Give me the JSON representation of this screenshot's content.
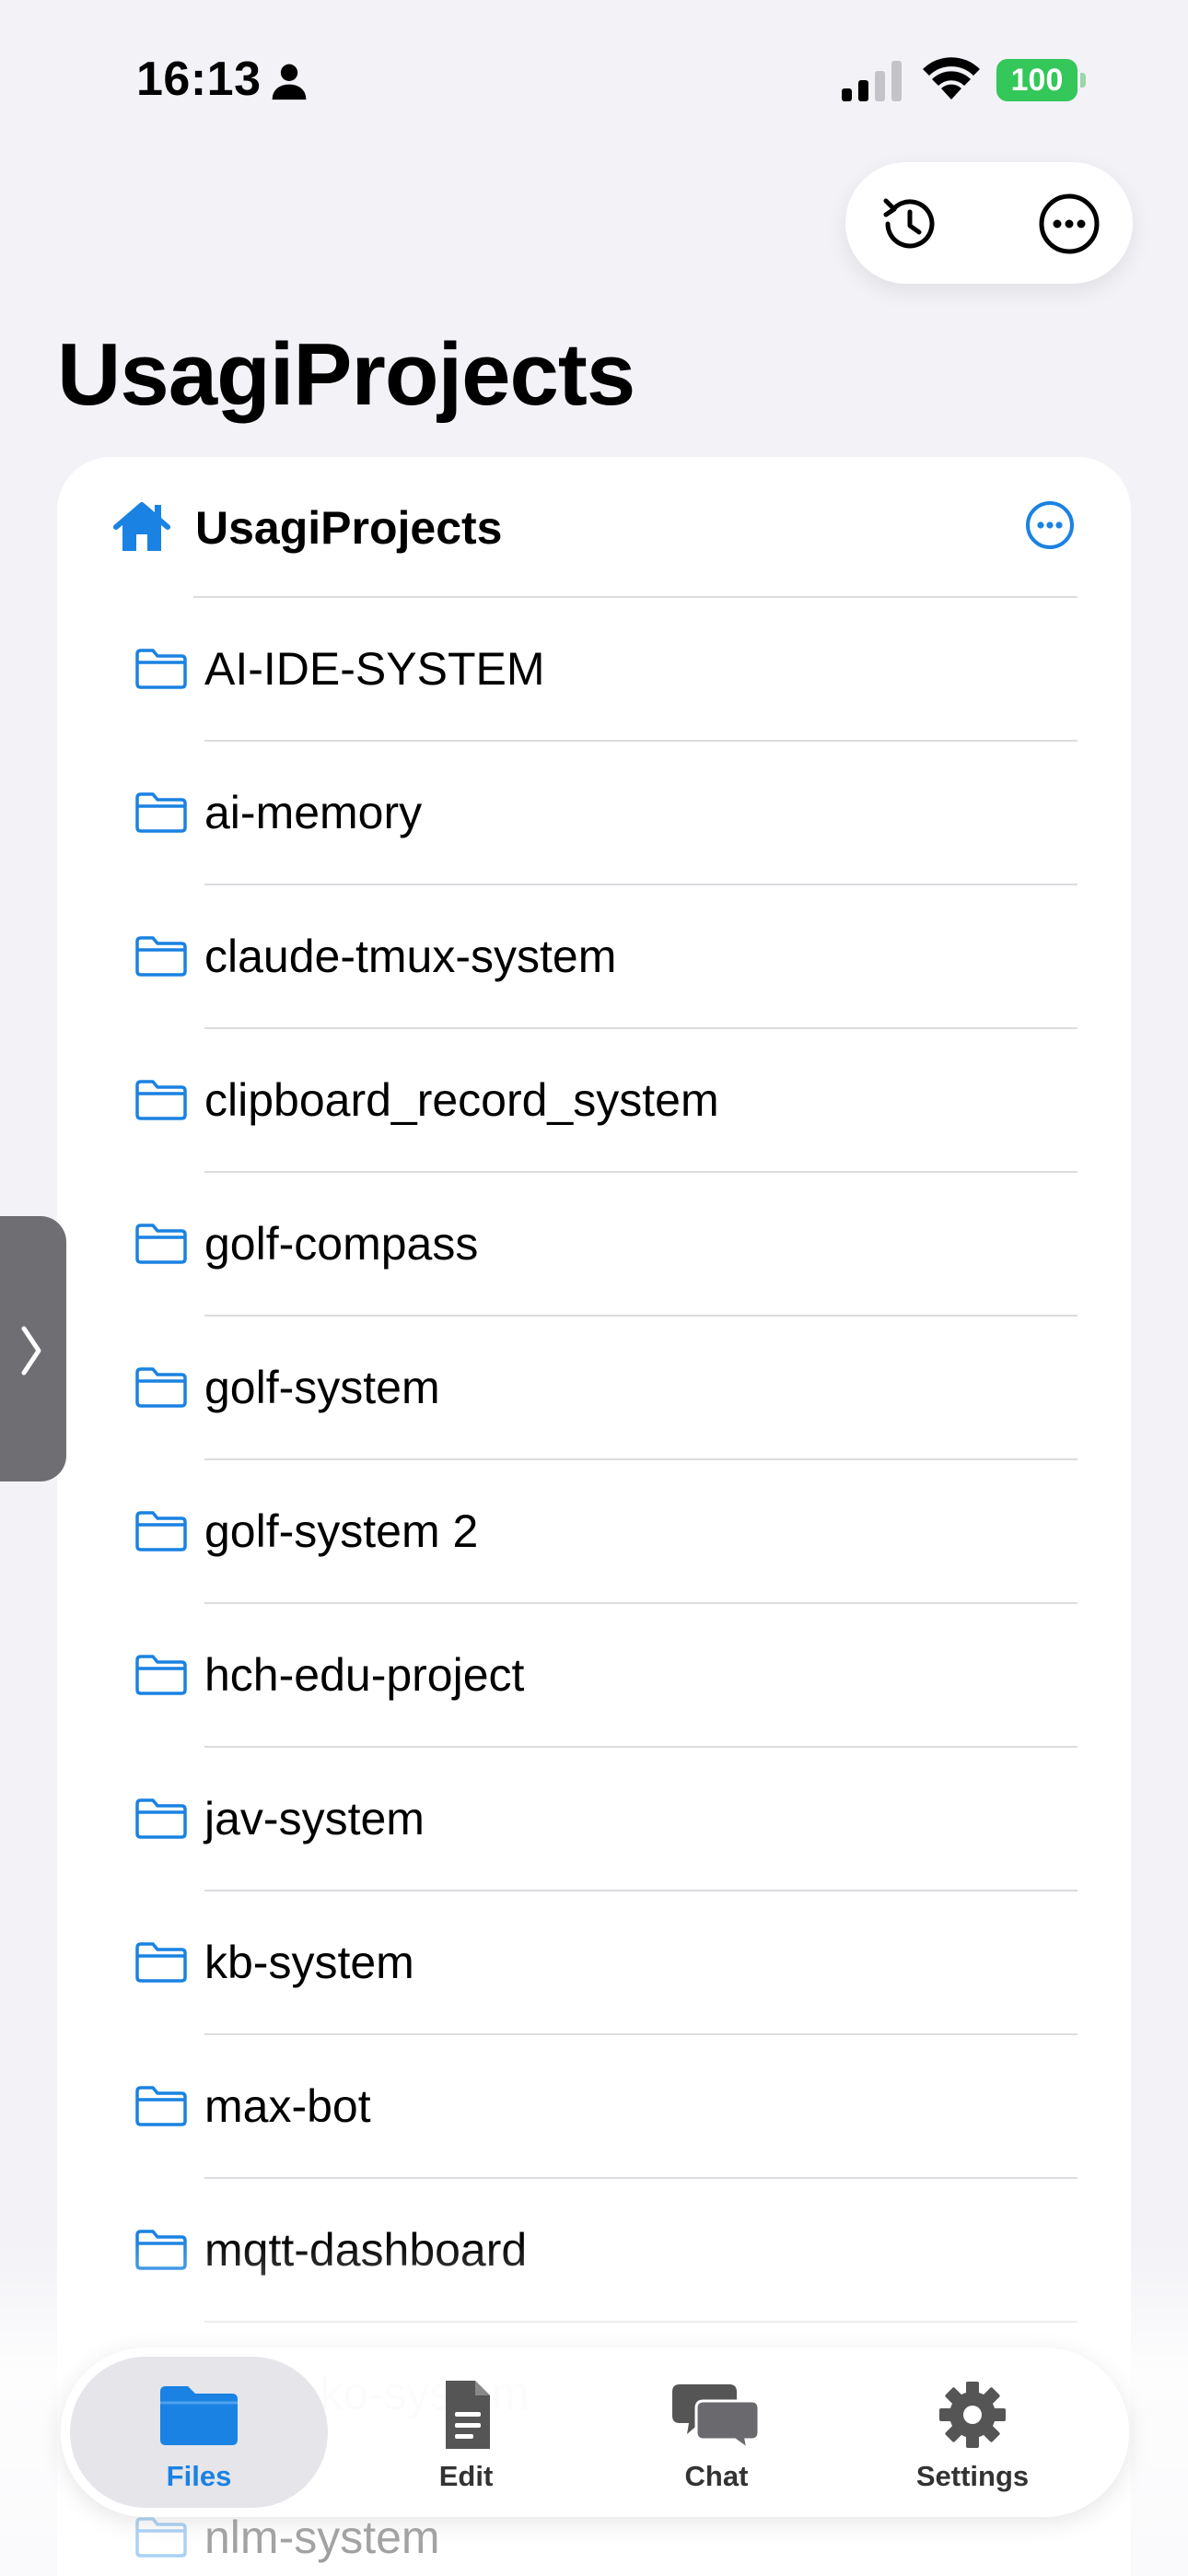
{
  "status_bar": {
    "time": "16:13",
    "battery": "100"
  },
  "page": {
    "title": "UsagiProjects"
  },
  "toolbar": {
    "history_icon": "clock-history-icon",
    "more_icon": "ellipsis-circle-icon"
  },
  "card": {
    "header_title": "UsagiProjects",
    "header_icon": "house-icon"
  },
  "folders": [
    "AI-IDE-SYSTEM",
    "ai-memory",
    "claude-tmux-system",
    "clipboard_record_system",
    "golf-compass",
    "golf-system",
    "golf-system 2",
    "hch-edu-project",
    "jav-system",
    "kb-system",
    "max-bot",
    "mqtt-dashboard",
    "nemoko-system",
    "nlm-system"
  ],
  "tabs": {
    "files": "Files",
    "edit": "Edit",
    "chat": "Chat",
    "settings": "Settings"
  },
  "colors": {
    "accent": "#1a82e2",
    "battery": "#34c759",
    "background": "#f2f2f7"
  }
}
